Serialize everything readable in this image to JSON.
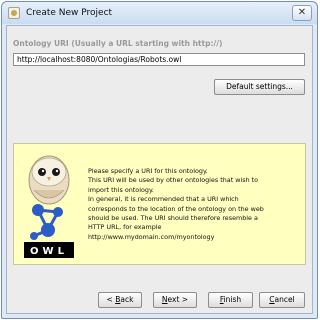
{
  "window": {
    "title": "Create New Project",
    "close_glyph": "✕"
  },
  "form": {
    "uri_label": "Ontology URI (Usually a URL starting with http://)",
    "uri_value": "http://localhost:8080/Ontologias/Robots.owl",
    "default_settings_label": "Default settings..."
  },
  "info": {
    "lines": [
      "Please specify a URI for this ontology.",
      "This URI will be used by other ontologies that wish to",
      "import this ontology.",
      "In general, it is recommended that a URI which",
      "corresponds to the location of the ontology on the web",
      "should be used. The URI should therefore resemble a",
      "HTTP URL, for example",
      "http://www.mydomain.com/myontology"
    ],
    "logo_text": "OWL"
  },
  "buttons": {
    "back_mnemonic": "B",
    "back_rest": "ack",
    "back_prefix": "< ",
    "next_mnemonic": "N",
    "next_rest": "ext >",
    "finish_mnemonic": "F",
    "finish_rest": "inish",
    "cancel_mnemonic": "C",
    "cancel_rest": "ancel"
  },
  "colors": {
    "panel": "#ffffc0",
    "owl_logo_blue": "#2b5cc8"
  }
}
